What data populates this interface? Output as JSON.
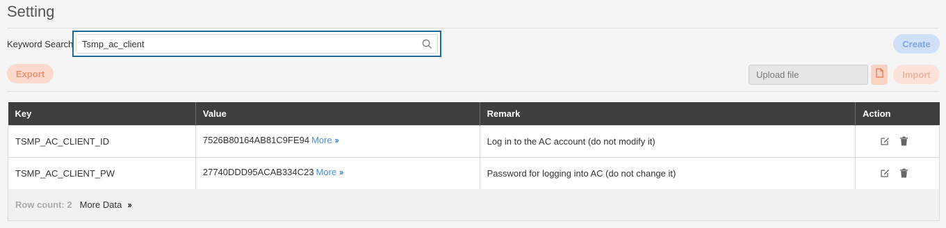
{
  "page": {
    "title": "Setting"
  },
  "search": {
    "label": "Keyword Search",
    "value": "Tsmp_ac_client",
    "placeholder": ""
  },
  "toolbar": {
    "create_label": "Create",
    "export_label": "Export",
    "upload_placeholder": "Upload file",
    "import_label": "Import"
  },
  "table": {
    "columns": [
      "Key",
      "Value",
      "Remark",
      "Action"
    ],
    "more_label": "More",
    "rows": [
      {
        "key": "TSMP_AC_CLIENT_ID",
        "value": "7526B80164AB81C9FE94",
        "remark": "Log in to the AC account (do not modify it)"
      },
      {
        "key": "TSMP_AC_CLIENT_PW",
        "value": "27740DDD95ACAB334C23",
        "remark": "Password for logging into AC (do not change it)"
      }
    ]
  },
  "footer": {
    "row_count": "Row count: 2",
    "more_data": "More Data"
  },
  "icons": {
    "search": "search-icon",
    "file": "file-icon",
    "edit": "edit-icon",
    "delete": "trash-icon",
    "chevron": "double-chevron-right-icon"
  },
  "colors": {
    "accent": "#1d6a96",
    "header_bg": "#3e3e3e",
    "link": "#4a90d9",
    "create_bg": "#cfe0f7",
    "export_bg": "#fbd9cc"
  }
}
